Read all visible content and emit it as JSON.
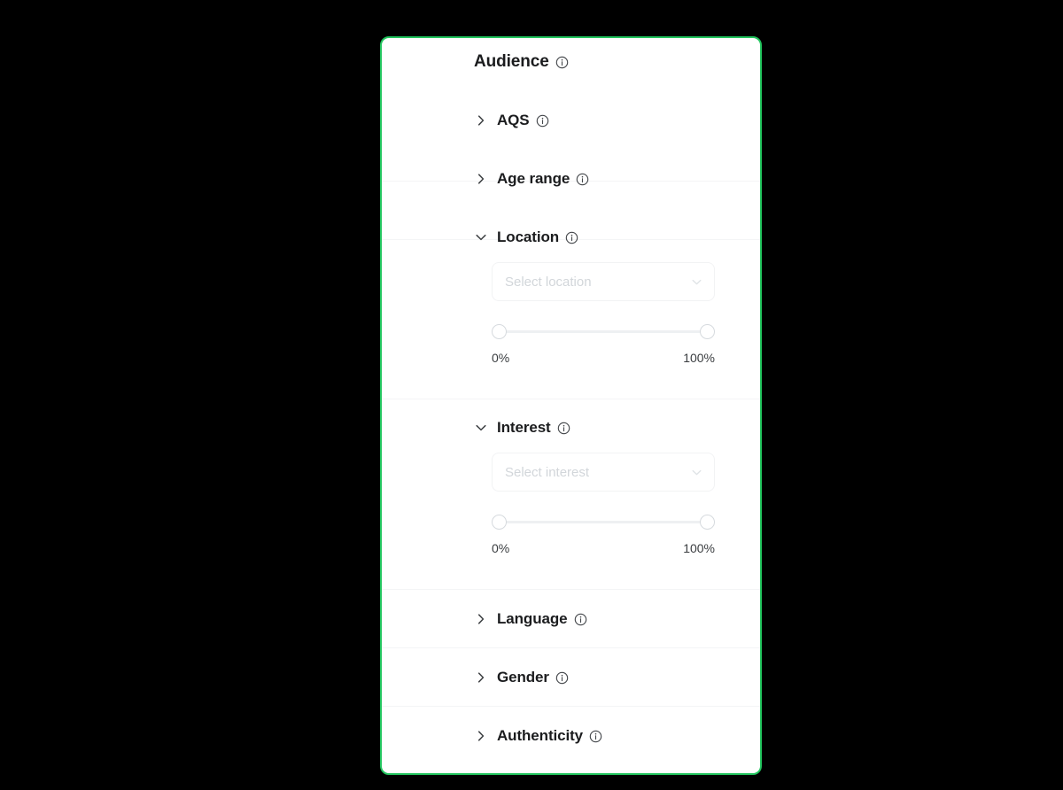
{
  "theme": {
    "page_background": "#000000",
    "card_background": "#ffffff",
    "card_border_accent": "#22c55e",
    "text_primary": "#1b1c1e",
    "placeholder_text": "#d2d6da",
    "slider_track": "#eef0f2",
    "slider_thumb_border": "#d6dade"
  },
  "panel": {
    "title": "Audience",
    "title_info_icon": "info-circle-icon"
  },
  "sections": [
    {
      "id": "aqs",
      "label": "AQS",
      "expanded": false,
      "toggle_icon": "chevron-right-icon",
      "info_icon": "info-circle-icon"
    },
    {
      "id": "age-range",
      "label": "Age range",
      "expanded": false,
      "toggle_icon": "chevron-right-icon",
      "info_icon": "info-circle-icon"
    },
    {
      "id": "location",
      "label": "Location",
      "expanded": true,
      "toggle_icon": "chevron-down-icon",
      "info_icon": "info-circle-icon",
      "select": {
        "value": "",
        "placeholder": "Select location",
        "chevron_icon": "chevron-down-icon"
      },
      "slider": {
        "min_label": "0%",
        "max_label": "100%",
        "min_value": 0,
        "max_value": 100
      }
    },
    {
      "id": "interest",
      "label": "Interest",
      "expanded": true,
      "toggle_icon": "chevron-down-icon",
      "info_icon": "info-circle-icon",
      "select": {
        "value": "",
        "placeholder": "Select interest",
        "chevron_icon": "chevron-down-icon"
      },
      "slider": {
        "min_label": "0%",
        "max_label": "100%",
        "min_value": 0,
        "max_value": 100
      }
    },
    {
      "id": "language",
      "label": "Language",
      "expanded": false,
      "toggle_icon": "chevron-right-icon",
      "info_icon": "info-circle-icon"
    },
    {
      "id": "gender",
      "label": "Gender",
      "expanded": false,
      "toggle_icon": "chevron-right-icon",
      "info_icon": "info-circle-icon"
    },
    {
      "id": "authenticity",
      "label": "Authenticity",
      "expanded": false,
      "toggle_icon": "chevron-right-icon",
      "info_icon": "info-circle-icon"
    }
  ]
}
